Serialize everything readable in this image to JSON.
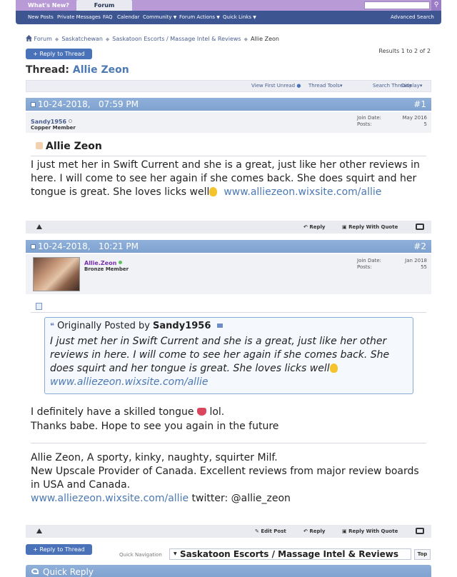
{
  "topbar": {
    "whats_new": "What's New?",
    "forum": "Forum"
  },
  "navbar": {
    "new_posts": "New Posts",
    "private_messages": "Private Messages",
    "faq": "FAQ",
    "calendar": "Calendar",
    "community": "Community",
    "forum_actions": "Forum Actions",
    "quick_links": "Quick Links",
    "advanced_search": "Advanced Search"
  },
  "breadcrumb": {
    "items": [
      "Forum",
      "Saskatchewan",
      "Saskatoon Escorts / Massage Intel & Reviews"
    ],
    "current": "Allie Zeon"
  },
  "reply_to_thread_label": "+ Reply to Thread",
  "results": "Results 1 to 2 of 2",
  "thread": {
    "label": "Thread:",
    "title": "Allie Zeon"
  },
  "tools": {
    "view_first_unread": "View First Unread",
    "thread_tools": "Thread Tools",
    "search_thread": "Search Thread",
    "display": "Display"
  },
  "posts": [
    {
      "date": "10-24-2018,",
      "time": "07:59 PM",
      "number": "#1",
      "username": "Sandy1956",
      "usertitle": "Copper Member",
      "join_label": "Join Date:",
      "join_date": "May 2016",
      "posts_label": "Posts:",
      "posts_count": "5",
      "title": "Allie Zeon",
      "body": "I just met her in Swift Current and she is a great, just like her other reviews in here. I will come to see her again if she comes back. She does squirt and her tongue is great. She loves licks well",
      "link": "www.alliezeon.wixsite.com/allie",
      "reply": "Reply",
      "reply_quote": "Reply With Quote"
    },
    {
      "date": "10-24-2018,",
      "time": "10:21 PM",
      "number": "#2",
      "username": "Allie.Zeon",
      "usertitle": "Bronze Member",
      "join_label": "Join Date:",
      "join_date": "Jan 2018",
      "posts_label": "Posts:",
      "posts_count": "55",
      "quote_prefix": "Originally Posted by",
      "quote_author": "Sandy1956",
      "quote_body": "I just met her in Swift Current and she is a great, just like her other reviews in here. I will come to see her again if she comes back. She does squirt and her tongue is great. She loves licks well",
      "quote_link": "www.alliezeon.wixsite.com/allie",
      "line1_a": "I definitely have a skilled tongue",
      "line1_b": "lol.",
      "line2": "Thanks babe. Hope to see you again in the future",
      "sig1": "Allie Zeon, A sporty, kinky, naughty, squirter Milf.",
      "sig2": "New Upscale Provider of Canada. Excellent reviews from major review boards in USA and Canada.",
      "sig_link": "www.alliezeon.wixsite.com/allie",
      "sig_twitter": "twitter: @allie_zeon",
      "edit_post": "Edit Post",
      "reply": "Reply",
      "reply_quote": "Reply With Quote"
    }
  ],
  "quick_nav": {
    "label": "Quick Navigation",
    "selected": "Saskatoon Escorts / Massage Intel & Reviews",
    "top": "Top"
  },
  "quick_reply": "Quick Reply",
  "colors": {
    "topbar": "#b79ad6",
    "navbar": "#3d5591",
    "post_header": "#8fb0d9",
    "link": "#4c79b3"
  }
}
